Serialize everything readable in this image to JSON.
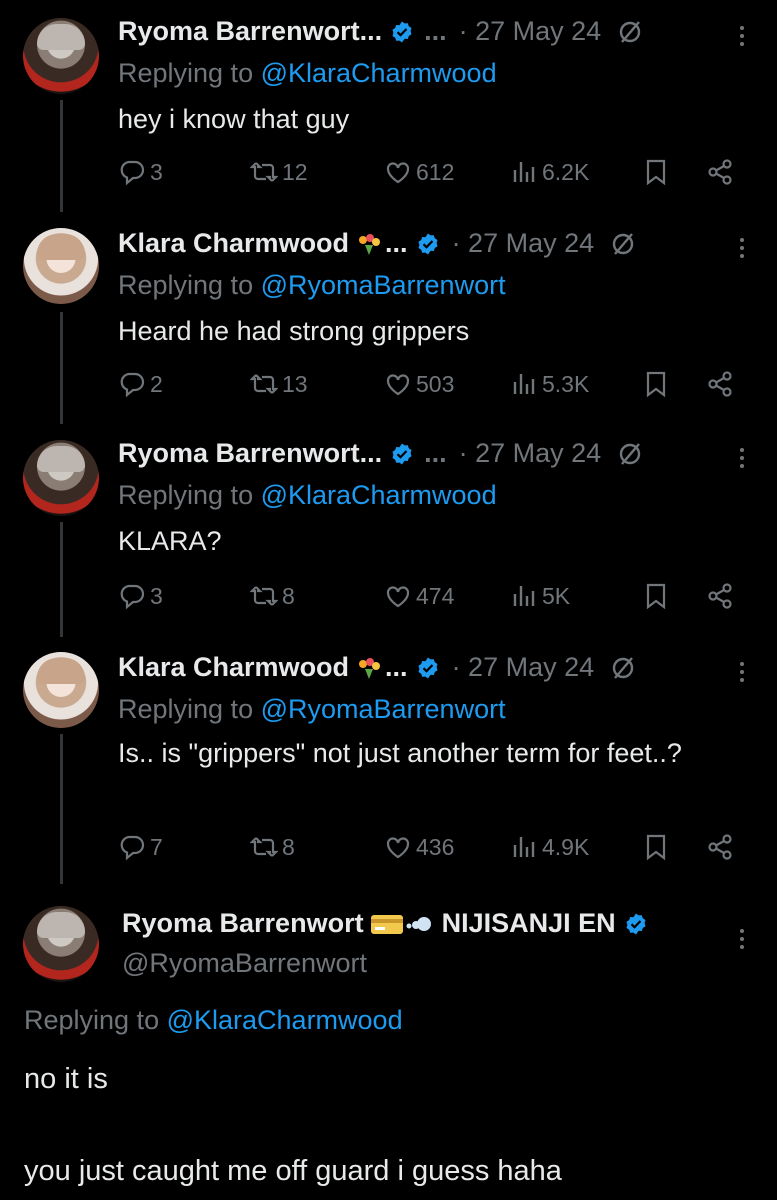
{
  "tweets": [
    {
      "name": "Ryoma Barrenwort...",
      "extra": "...",
      "date": "· 27 May 24",
      "replying_prefix": "Replying to ",
      "replying_to": "@KlaraCharmwood",
      "text": "hey i know that guy",
      "replies": "3",
      "reposts": "12",
      "likes": "612",
      "views": "6.2K"
    },
    {
      "name": "Klara Charmwood",
      "extra": "...",
      "date": "· 27 May 24",
      "replying_prefix": "Replying to ",
      "replying_to": "@RyomaBarrenwort",
      "text": "Heard he had strong grippers",
      "replies": "2",
      "reposts": "13",
      "likes": "503",
      "views": "5.3K"
    },
    {
      "name": "Ryoma Barrenwort...",
      "extra": "...",
      "date": "· 27 May 24",
      "replying_prefix": "Replying to ",
      "replying_to": "@KlaraCharmwood",
      "text": "KLARA?",
      "replies": "3",
      "reposts": "8",
      "likes": "474",
      "views": "5K"
    },
    {
      "name": "Klara Charmwood",
      "extra": "...",
      "date": "· 27 May 24",
      "replying_prefix": "Replying to ",
      "replying_to": "@RyomaBarrenwort",
      "text": "Is.. is \"grippers\" not just another term for feet..?",
      "replies": "7",
      "reposts": "8",
      "likes": "436",
      "views": "4.9K"
    }
  ],
  "main": {
    "name": "Ryoma Barrenwort",
    "suffix": "NIJISANJI EN",
    "handle": "@RyomaBarrenwort",
    "replying_prefix": "Replying to ",
    "replying_to": "@KlaraCharmwood",
    "text_line1": "no it is",
    "text_line2": "you just caught me off guard i guess haha"
  },
  "colors": {
    "background": "#000000",
    "text": "#e7e9ea",
    "muted": "#71767b",
    "link": "#1d9bf0",
    "verified": "#1d9bf0"
  },
  "icons": [
    "reply-icon",
    "repost-icon",
    "like-icon",
    "views-icon",
    "bookmark-icon",
    "share-icon",
    "grok-slash-icon",
    "more-icon",
    "verified-icon"
  ]
}
